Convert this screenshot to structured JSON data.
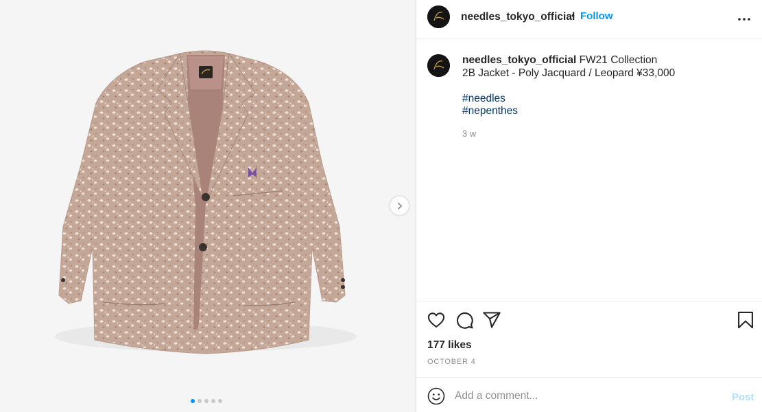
{
  "media": {
    "image_alt": "Leopard jacquard two-button jacket",
    "carousel_dots": 5,
    "active_dot": 0
  },
  "post": {
    "username": "needles_tokyo_official",
    "separator": "•",
    "follow_label": "Follow",
    "caption_line1": "FW21 Collection",
    "caption_line2": "2B Jacket - Poly Jacquard / Leopard ¥33,000",
    "hashtags": [
      "#needles",
      "#nepenthes"
    ],
    "time_ago": "3 w",
    "likes": "177 likes",
    "date": "OCTOBER 4"
  },
  "comment": {
    "placeholder": "Add a comment...",
    "post_label": "Post"
  },
  "icons": {
    "more": "more-options-icon",
    "like": "heart-icon",
    "comment": "comment-icon",
    "share": "share-icon",
    "save": "bookmark-icon",
    "emoji": "emoji-icon",
    "next": "chevron-right-icon"
  },
  "colors": {
    "accent": "#0095f6",
    "hashtag": "#00376b",
    "muted": "#8e8e8e",
    "post_disabled": "#b2dffc",
    "jacket": "#c6ab9c"
  }
}
